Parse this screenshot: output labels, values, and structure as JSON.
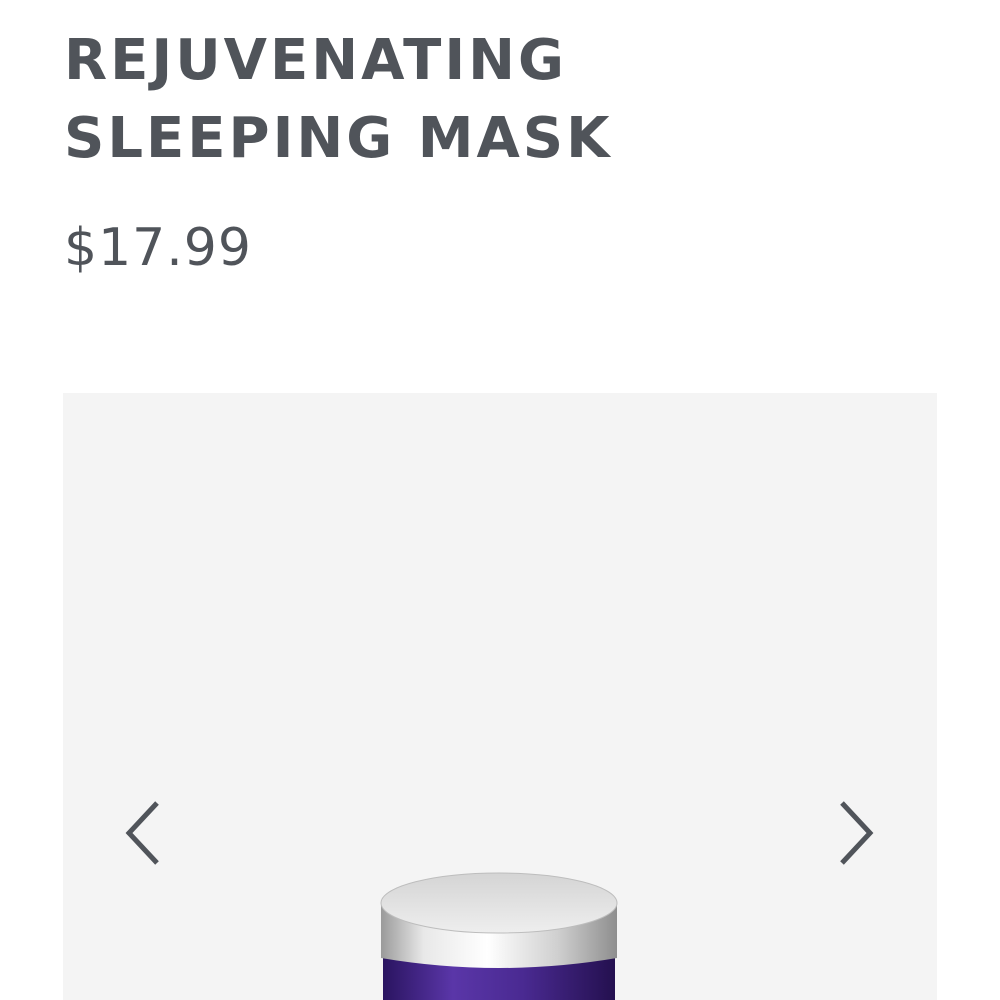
{
  "product": {
    "title_line_1": "REJUVENATING",
    "title_line_2": "SLEEPING MASK",
    "price": "$17.99"
  },
  "gallery": {
    "prev_icon": "chevron-left-icon",
    "next_icon": "chevron-right-icon",
    "image_alt": "Rejuvenating Sleeping Mask jar",
    "colors": {
      "background": "#f4f4f4",
      "lid": "#d9d9d9",
      "jar": "#4b2a8c",
      "chevron": "#50545a"
    }
  }
}
